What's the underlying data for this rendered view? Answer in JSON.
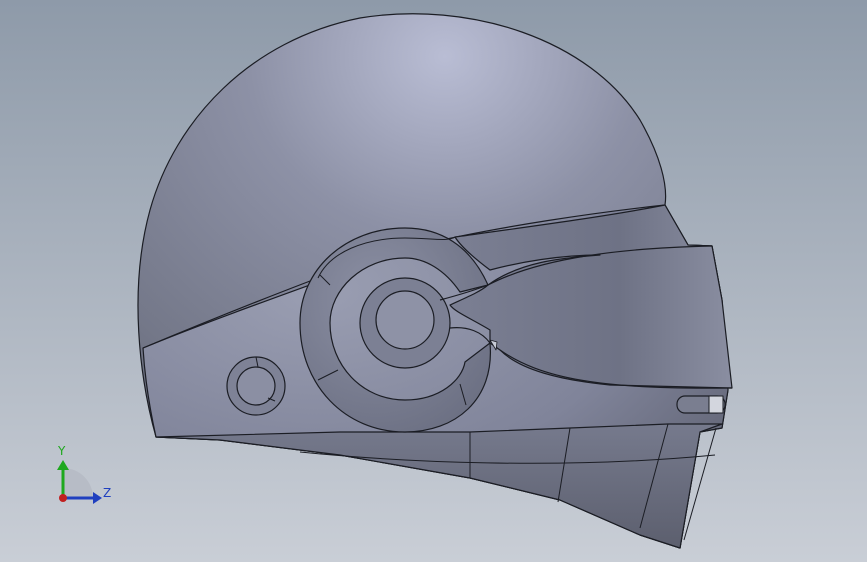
{
  "viewport": {
    "background_top": "#8e9aa9",
    "background_bottom": "#c9ced6"
  },
  "model": {
    "shell_light": "#a6abbf",
    "shell_mid": "#878b9e",
    "shell_dark": "#63677a",
    "edge_color": "#1b1d24"
  },
  "triad": {
    "y_label": "Y",
    "z_label": "Z",
    "y_color": "#1ea81e",
    "z_color": "#1f3fbf",
    "x_color": "#c01f1f"
  }
}
